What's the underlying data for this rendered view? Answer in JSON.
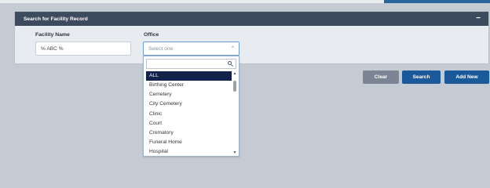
{
  "panel": {
    "title": "Search for Facility Record",
    "collapse_symbol": "−"
  },
  "form": {
    "facility_name_label": "Facility Name",
    "facility_name_value": "% ABC %",
    "office_label": "Office",
    "office_placeholder": "Select one",
    "office_caret": "^"
  },
  "dropdown": {
    "options": [
      "ALL",
      "Birthing Center",
      "Cemetery",
      "City Cemetery",
      "Clinic",
      "Court",
      "Crematory",
      "Funeral Home",
      "Hospital"
    ],
    "selected_index": 0,
    "scroll_up": "▲",
    "scroll_down": "▼"
  },
  "buttons": {
    "clear": "Clear",
    "search": "Search",
    "add_new": "Add New"
  },
  "colors": {
    "header_bg": "#3d4b5f",
    "primary_button": "#1a5a9a",
    "secondary_button": "#7b8594",
    "selected_option": "#12224a"
  }
}
